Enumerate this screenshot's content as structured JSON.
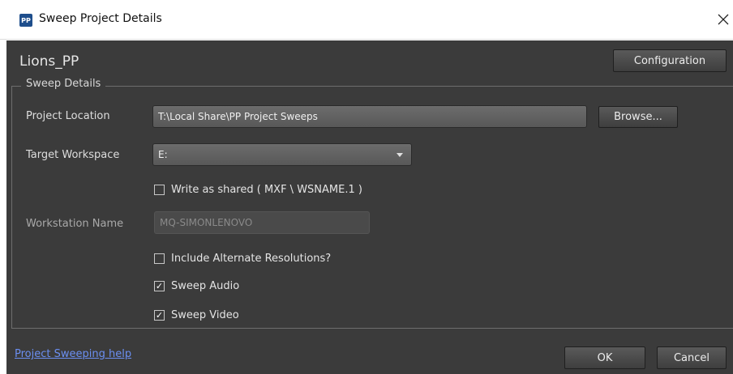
{
  "window": {
    "icon_text": "PP",
    "title": "Sweep Project Details",
    "close_glyph": "×"
  },
  "project": {
    "name": "Lions_PP"
  },
  "buttons": {
    "configuration": "Configuration",
    "browse": "Browse...",
    "ok": "OK",
    "cancel": "Cancel"
  },
  "sweep_details": {
    "legend": "Sweep Details",
    "project_location_label": "Project Location",
    "project_location_value": "T:\\Local Share\\PP Project Sweeps",
    "target_workspace_label": "Target Workspace",
    "target_workspace_value": "E:",
    "write_as_shared": {
      "label": "Write as shared ( MXF \\ WSNAME.1 )",
      "checked": false,
      "mark": ""
    },
    "workstation_name_label": "Workstation Name",
    "workstation_name_value": "MQ-SIMONLENOVO",
    "include_alternate": {
      "label": "Include Alternate Resolutions?",
      "checked": false,
      "mark": ""
    },
    "sweep_audio": {
      "label": "Sweep Audio",
      "checked": true,
      "mark": "✓"
    },
    "sweep_video": {
      "label": "Sweep Video",
      "checked": true,
      "mark": "✓"
    }
  },
  "footer": {
    "help_link": "Project Sweeping help"
  },
  "colors": {
    "dialog_background": "#3b3b3b",
    "link": "#6b8ff2",
    "app_icon": "#1e4e8c"
  },
  "icons": {
    "app": "pp-app-icon",
    "close": "close-icon",
    "dropdown": "chevron-down-icon",
    "check": "checkmark-icon"
  }
}
